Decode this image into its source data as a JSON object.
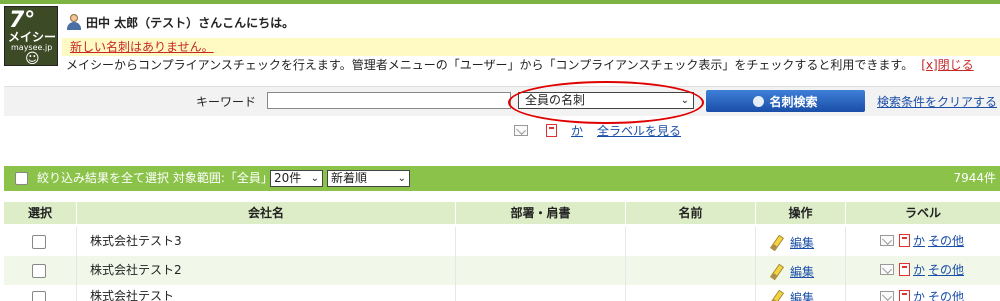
{
  "brand": {
    "logo_line1": "7°",
    "logo_line2": "メイシー",
    "logo_line3": "maysee.jp",
    "logo_line4": "☺"
  },
  "header": {
    "greeting": "田中 太郎（テスト）さんこんにちは。"
  },
  "notice": {
    "new_cards": "新しい名刺はありません。",
    "info_text": "メイシーからコンプライアンスチェックを行えます。管理者メニューの「ユーザー」から「コンプライアンスチェック表示」をチェックすると利用できます。",
    "close_label": "[x]閉じる"
  },
  "search": {
    "keyword_label": "キーワード",
    "keyword_value": "",
    "scope_selected": "全員の名刺",
    "search_button": "名刺検索",
    "clear_link": "検索条件をクリアする"
  },
  "label_bar": {
    "label_ka": "か",
    "all_labels": "全ラベルを見る"
  },
  "result_bar": {
    "select_all": "絞り込み結果を全て選択",
    "scope_text": "対象範囲:「全員」",
    "per_page": "20件",
    "sort": "新着順",
    "count": "7944件"
  },
  "table": {
    "headers": [
      "選択",
      "会社名",
      "部署・肩書",
      "名前",
      "操作",
      "ラベル"
    ],
    "rows": [
      {
        "company": "株式会社テスト3",
        "dept": "",
        "name": "",
        "edit": "編集",
        "label_ka": "か",
        "label_other": "その他"
      },
      {
        "company": "株式会社テスト2",
        "dept": "",
        "name": "",
        "edit": "編集",
        "label_ka": "か",
        "label_other": "その他"
      },
      {
        "company": "株式会社テスト",
        "dept": "",
        "name": "",
        "edit": "編集",
        "label_ka": "か",
        "label_other": "その他"
      }
    ]
  },
  "colors": {
    "accent_green": "#8bc34a",
    "header_green": "#dcedc8",
    "search_blue": "#1a4ea8",
    "notice_red": "#c62828",
    "highlight_ellipse": "#e00000"
  }
}
